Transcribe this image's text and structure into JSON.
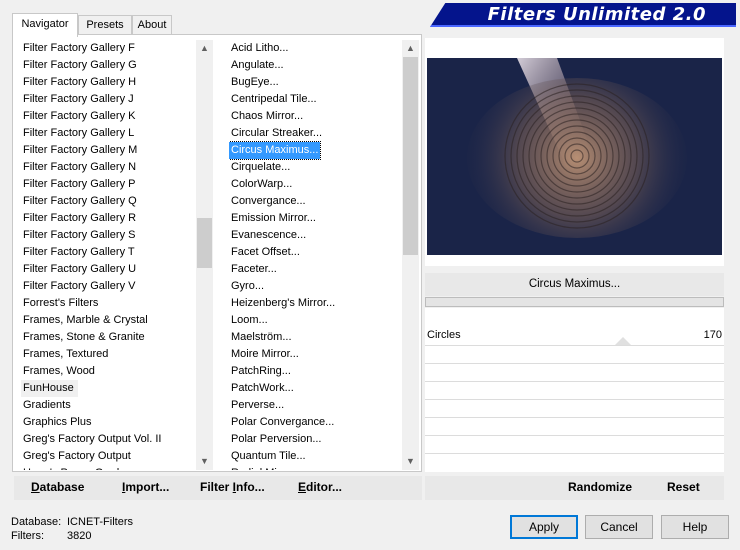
{
  "tabs": [
    "Navigator",
    "Presets",
    "About"
  ],
  "active_tab": "Navigator",
  "title": "Filters Unlimited 2.0",
  "categories": [
    "Filter Factory Gallery F",
    "Filter Factory Gallery G",
    "Filter Factory Gallery H",
    "Filter Factory Gallery J",
    "Filter Factory Gallery K",
    "Filter Factory Gallery L",
    "Filter Factory Gallery M",
    "Filter Factory Gallery N",
    "Filter Factory Gallery P",
    "Filter Factory Gallery Q",
    "Filter Factory Gallery R",
    "Filter Factory Gallery S",
    "Filter Factory Gallery T",
    "Filter Factory Gallery U",
    "Filter Factory Gallery V",
    "Forrest's Filters",
    "Frames, Marble & Crystal",
    "Frames, Stone & Granite",
    "Frames, Textured",
    "Frames, Wood",
    "FunHouse",
    "Gradients",
    "Graphics Plus",
    "Greg's Factory Output Vol. II",
    "Greg's Factory Output",
    "Harry's Power Grads"
  ],
  "selected_category": "FunHouse",
  "filters": [
    "Acid Litho...",
    "Angulate...",
    "BugEye...",
    "Centripedal Tile...",
    "Chaos Mirror...",
    "Circular Streaker...",
    "Circus Maximus...",
    "Cirquelate...",
    "ColorWarp...",
    "Convergance...",
    "Emission Mirror...",
    "Evanescence...",
    "Facet Offset...",
    "Faceter...",
    "Gyro...",
    "Heizenberg's Mirror...",
    "Loom...",
    "Maelström...",
    "Moire Mirror...",
    "PatchRing...",
    "PatchWork...",
    "Perverse...",
    "Polar Convergance...",
    "Polar Perversion...",
    "Quantum Tile...",
    "Radial Mirror..."
  ],
  "selected_filter": "Circus Maximus...",
  "filter_title": "Circus Maximus...",
  "control": {
    "label": "Circles",
    "value": "170"
  },
  "left_buttons": [
    {
      "pre": "",
      "acc": "D",
      "post": "atabase"
    },
    {
      "pre": "",
      "acc": "I",
      "post": "mport..."
    },
    {
      "pre": "Filter ",
      "acc": "I",
      "post": "nfo..."
    },
    {
      "pre": "",
      "acc": "E",
      "post": "ditor..."
    }
  ],
  "right_buttons": {
    "randomize": "Randomize",
    "reset": "Reset"
  },
  "status": {
    "database_label": "Database:",
    "database_value": "ICNET-Filters",
    "filters_label": "Filters:",
    "filters_value": "3820"
  },
  "dialog_buttons": {
    "apply": "Apply",
    "cancel": "Cancel",
    "help": "Help"
  },
  "colors": {
    "banner": "#04148c",
    "selection": "#3399ff",
    "preview_bg": "#1a2448"
  }
}
